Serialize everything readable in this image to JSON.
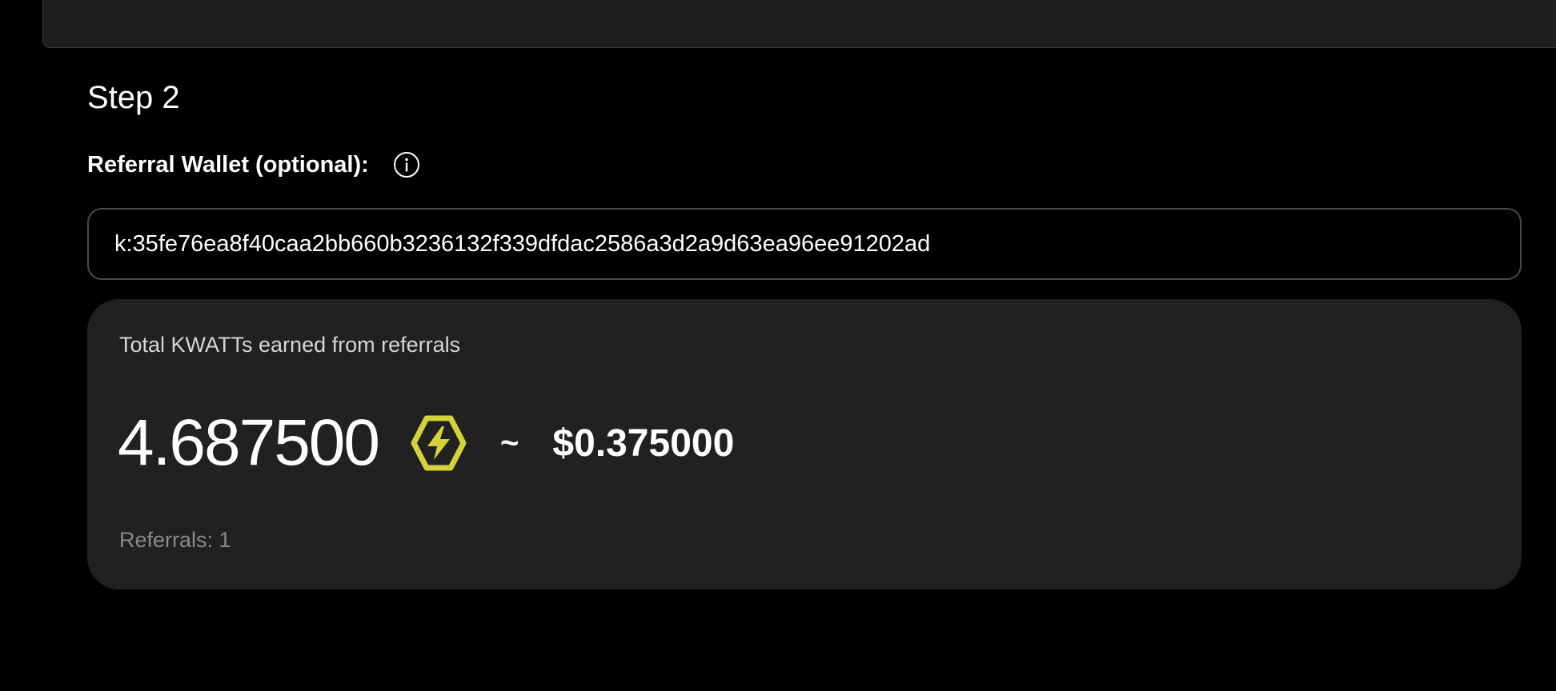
{
  "step": {
    "title": "Step 2"
  },
  "referral_wallet": {
    "label": "Referral Wallet (optional):",
    "info_icon": "info-circle-icon",
    "value": "k:35fe76ea8f40caa2bb660b3236132f339dfdac2586a3d2a9d63ea96ee91202ad"
  },
  "earnings": {
    "heading": "Total KWATTs earned from referrals",
    "kwatt_amount": "4.687500",
    "token_icon": "lightning-bolt-hexagon-icon",
    "approx_symbol": "~",
    "usd_amount": "$0.375000",
    "referrals": "Referrals: 1"
  },
  "colors": {
    "background": "#000000",
    "card": "#212121",
    "token_accent": "#d4d23a",
    "muted_text": "#8a8a8a"
  }
}
